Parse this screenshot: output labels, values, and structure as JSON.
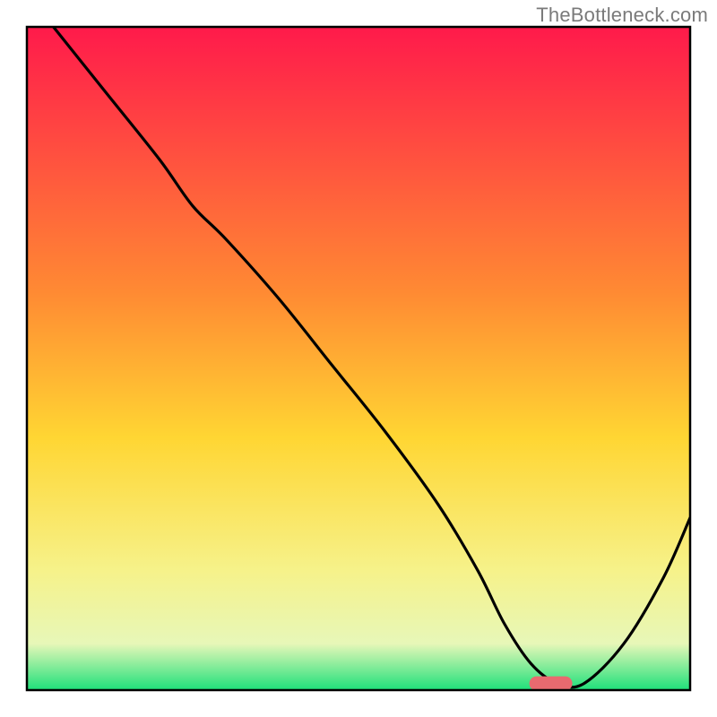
{
  "watermark": "TheBottleneck.com",
  "chart_data": {
    "type": "line",
    "title": "",
    "xlabel": "",
    "ylabel": "",
    "xlim": [
      0,
      100
    ],
    "ylim": [
      0,
      100
    ],
    "x": [
      4,
      12,
      20,
      25,
      30,
      38,
      46,
      54,
      62,
      68,
      72,
      76,
      80,
      84,
      90,
      96,
      100
    ],
    "y": [
      100,
      90,
      80,
      73,
      68,
      59,
      49,
      39,
      28,
      18,
      10,
      4,
      1,
      1,
      7,
      17,
      26
    ],
    "marker_point": {
      "x": 79,
      "y": 1
    },
    "gradient": {
      "top": "#ff1a4b",
      "mid_upper": "#ff8a33",
      "mid": "#ffd633",
      "mid_lower": "#f6f28a",
      "lower": "#e7f7b8",
      "bottom": "#1ee07a"
    },
    "curve_color": "#000000",
    "marker_color": "#e86a6f",
    "frame_color": "#000000"
  }
}
